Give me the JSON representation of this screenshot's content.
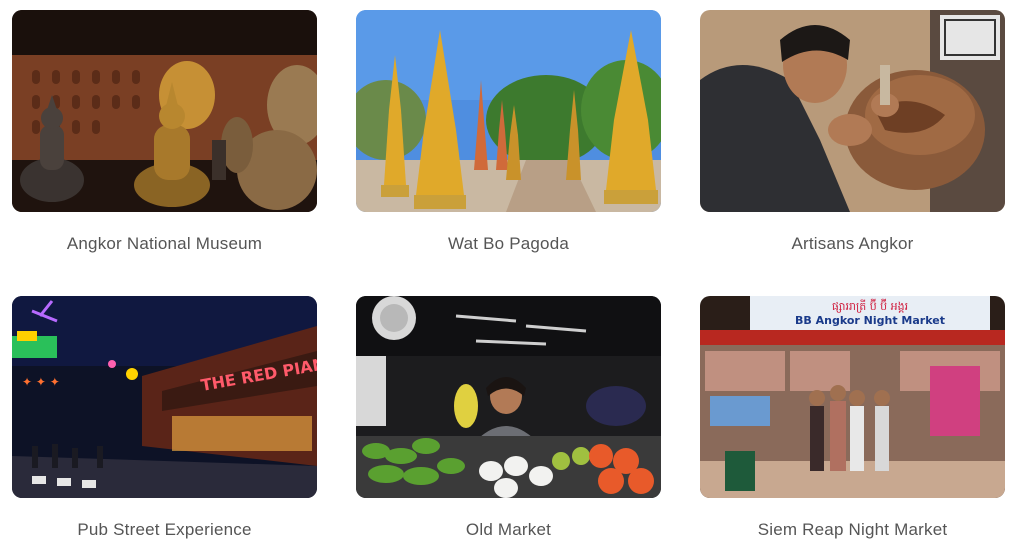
{
  "attractions": [
    {
      "name": "Angkor National Museum",
      "image": "museum-buddha-statues"
    },
    {
      "name": "Wat Bo Pagoda",
      "image": "golden-stupas"
    },
    {
      "name": "Artisans Angkor",
      "image": "wood-carver"
    },
    {
      "name": "Pub Street Experience",
      "image": "neon-street-night"
    },
    {
      "name": "Old Market",
      "image": "fruit-vendor"
    },
    {
      "name": "Siem Reap Night Market",
      "image": "night-market-stalls"
    }
  ],
  "signs": {
    "red_piano": "THE RED PIANO",
    "night_market_khmer": "ផ្សាររាត្រី ប៊ី ប៊ី អង្គរ",
    "night_market": "BB Angkor Night Market"
  }
}
